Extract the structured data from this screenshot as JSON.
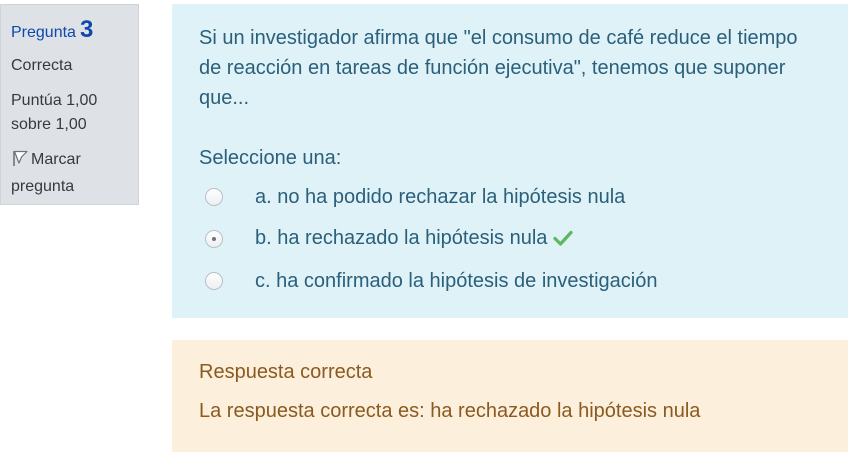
{
  "info": {
    "question_label": "Pregunta",
    "question_number": "3",
    "state": "Correcta",
    "grade_line1": "Puntúa 1,00",
    "grade_line2": "sobre 1,00",
    "flag_line1": "Marcar",
    "flag_line2": "pregunta",
    "flag_icon": "flag-icon"
  },
  "question": {
    "text": "Si un investigador afirma que \"el consumo de café reduce el tiempo de reacción en tareas de función ejecutiva\", tenemos que suponer que...",
    "prompt": "Seleccione una:",
    "options": [
      {
        "label": "a. no ha podido rechazar la hipótesis nula",
        "selected": false
      },
      {
        "label": "b. ha rechazado la hipótesis nula",
        "selected": true,
        "correct_icon": "check-icon"
      },
      {
        "label": "c. ha confirmado la hipótesis de investigación",
        "selected": false
      }
    ]
  },
  "feedback": {
    "status": "Respuesta correcta",
    "answer": "La respuesta correcta es: ha rechazado la hipótesis nula"
  },
  "colors": {
    "question_bg": "#def2f8",
    "feedback_bg": "#fcefdc",
    "info_bg": "#dee2e6",
    "accent_blue": "#0f47ad",
    "check_green": "#5cb85c"
  }
}
